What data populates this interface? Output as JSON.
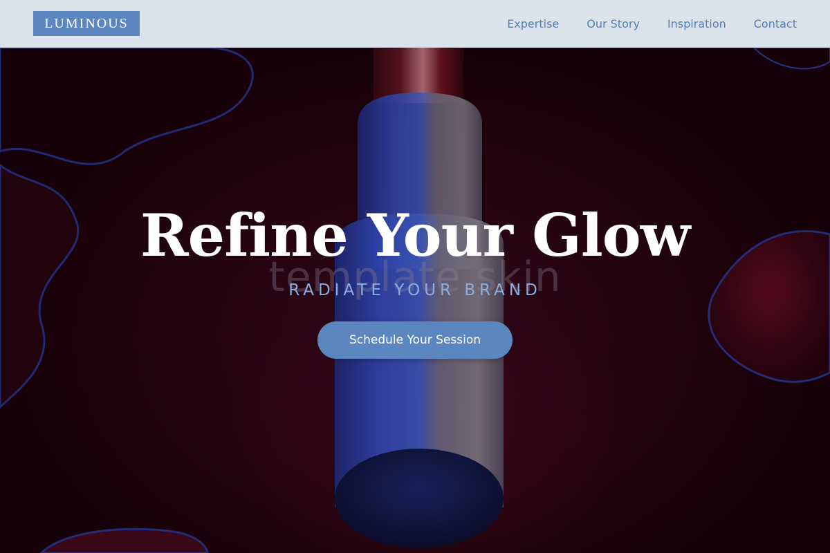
{
  "header": {
    "logo": "LUMINOUS",
    "nav": [
      {
        "label": "Expertise"
      },
      {
        "label": "Our Story"
      },
      {
        "label": "Inspiration"
      },
      {
        "label": "Contact"
      }
    ]
  },
  "hero": {
    "headline": "Refine Your Glow",
    "subheadline": "RADIATE YOUR BRAND",
    "watermark": "template skin",
    "cta_label": "Schedule Your Session"
  },
  "colors": {
    "accent": "#5b86bf",
    "header_bg": "#dde3ea",
    "nav_text": "#4f7db6",
    "hero_bg": "#24040f",
    "subheadline": "#8aaee0"
  }
}
